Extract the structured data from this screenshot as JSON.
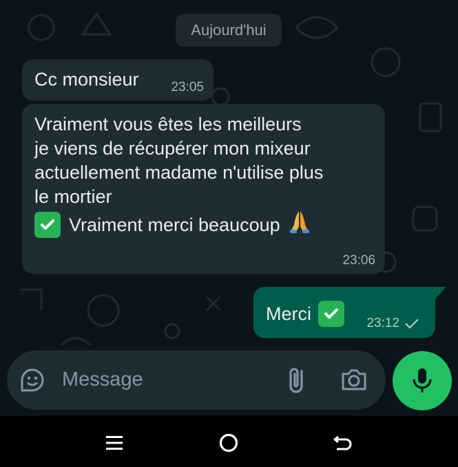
{
  "chat": {
    "date_separator": "Aujourd'hui",
    "messages": [
      {
        "direction": "in",
        "text": "Cc monsieur",
        "time": "23:05"
      },
      {
        "direction": "in",
        "lines": [
          "Vraiment vous êtes les meilleurs",
          "je viens de récupérer mon mixeur",
          "actuellement madame n'utilise plus",
          "le mortier"
        ],
        "last_line": "Vraiment merci beaucoup",
        "emojis": [
          "check-mark-button",
          "folded-hands"
        ],
        "time": "23:06"
      },
      {
        "direction": "out",
        "text": "Merci",
        "emoji": "check-mark-button",
        "time": "23:12",
        "status": "sent"
      }
    ]
  },
  "composer": {
    "placeholder": "Message",
    "icons": [
      "sticker-icon",
      "attach-icon",
      "camera-icon",
      "mic-icon"
    ]
  },
  "navigation": {
    "buttons": [
      "recent-apps",
      "home",
      "back"
    ]
  },
  "colors": {
    "background": "#0b141a",
    "incoming_bubble": "#1f2c34",
    "outgoing_bubble": "#005c4b",
    "accent": "#21c063"
  }
}
